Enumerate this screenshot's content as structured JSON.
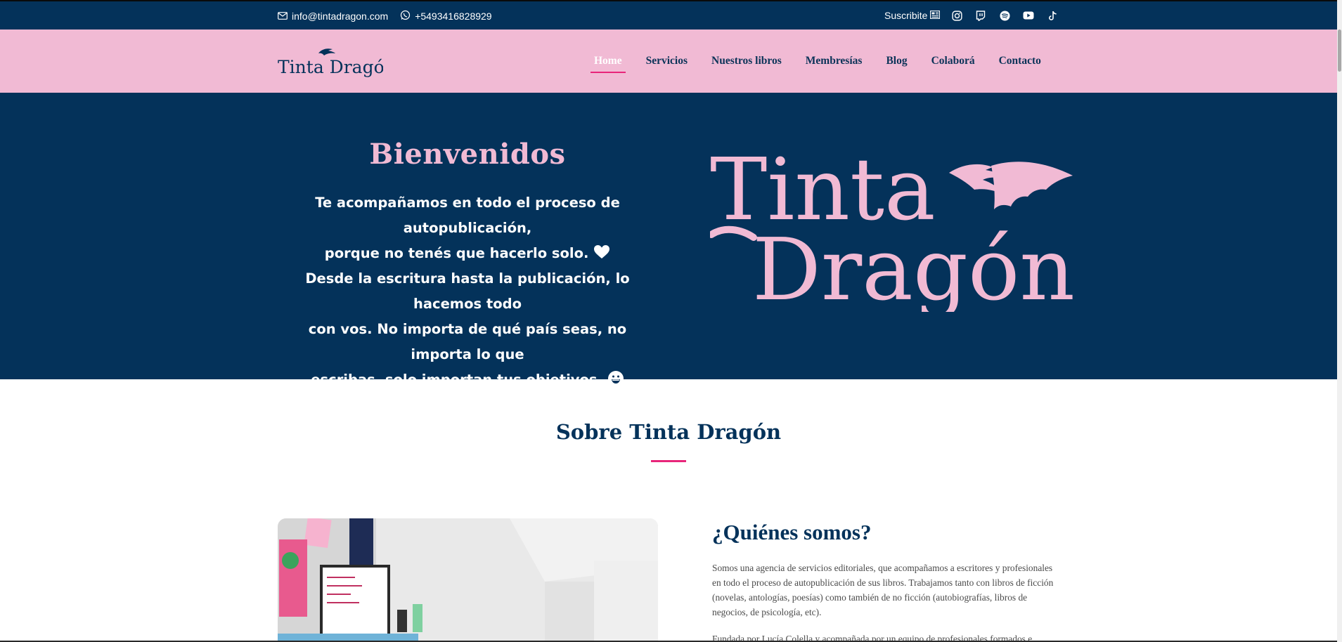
{
  "topbar": {
    "email": "info@tintadragon.com",
    "phone": "+5493416828929",
    "subscribe_label": "Suscribite",
    "icons": [
      "mail-icon",
      "whatsapp-icon",
      "newsletter-icon",
      "instagram-icon",
      "twitch-icon",
      "spotify-icon",
      "youtube-icon",
      "tiktok-icon"
    ]
  },
  "nav": {
    "logo_text": "Tinta Dragón",
    "items": [
      "Home",
      "Servicios",
      "Nuestros libros",
      "Membresías",
      "Blog",
      "Colaborá",
      "Contacto"
    ],
    "active": "Home"
  },
  "hero": {
    "title": "Bienvenidos",
    "line1": "Te acompañamos en todo el proceso de autopublicación,",
    "line2": "porque no tenés que hacerlo solo.",
    "line3": "Desde la escritura hasta la publicación, lo hacemos todo",
    "line4": "con vos. No importa de qué país seas, no importa lo que",
    "line5": "escribas, solo importan tus objetivos.",
    "logo_line1": "Tinta",
    "logo_line2": "Dragón"
  },
  "sobre": {
    "title": "Sobre Tinta Dragón",
    "quienes_title": "¿Quiénes somos?",
    "quienes_text": "Somos una agencia de servicios editoriales, que acompañamos a escritores y profesionales en todo el proceso de autopublicación de sus libros. Trabajamos tanto con libros de ficción (novelas, antologías, poesías) como también de no ficción (autobiografías, libros de negocios, de psicología, etc).",
    "quienes_text2": "Fundada por Lucía Colella y acompañada por un equipo de profesionales formados e"
  },
  "colors": {
    "navy": "#04325a",
    "pink": "#f1bad4",
    "accent": "#e8257a"
  }
}
